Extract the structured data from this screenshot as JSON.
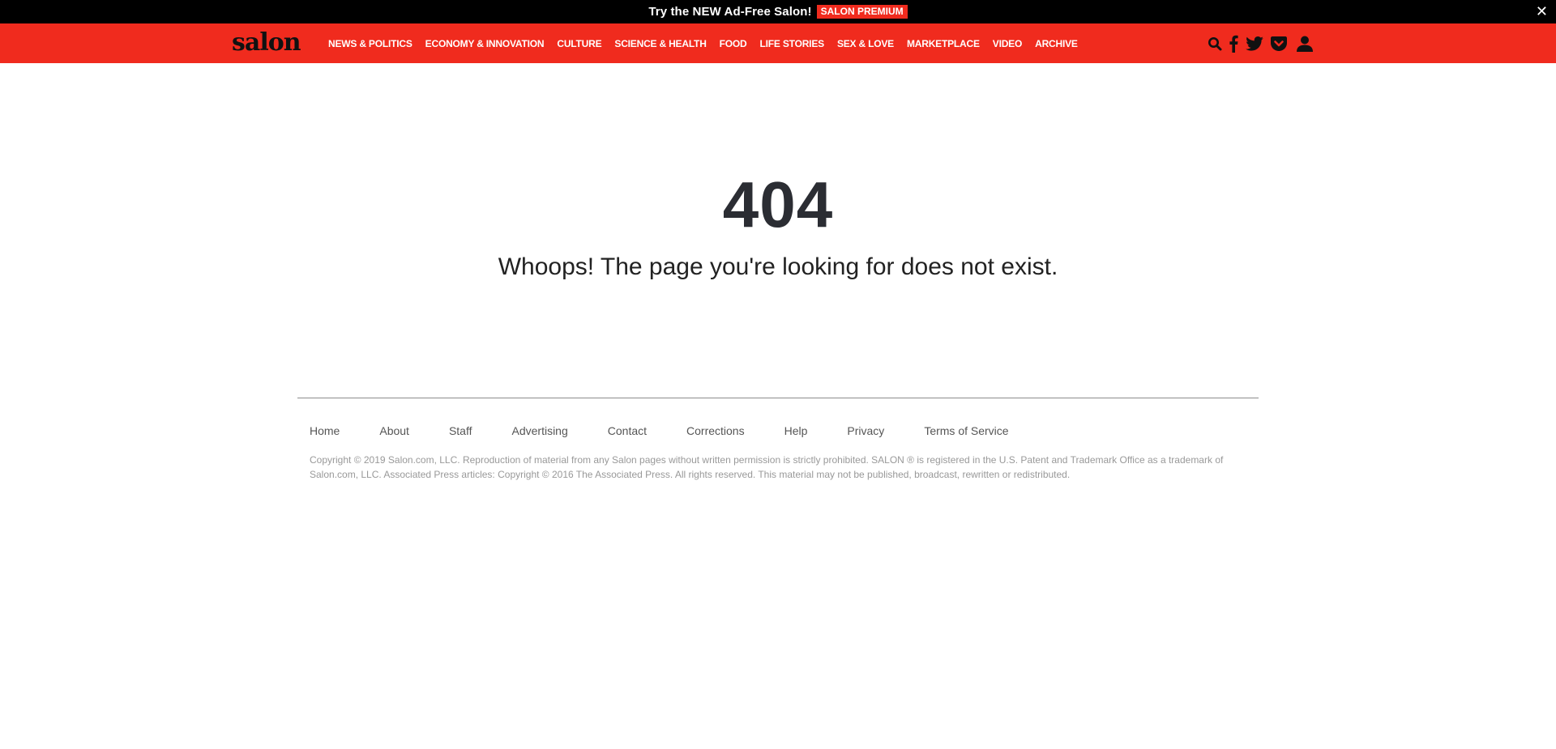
{
  "promo": {
    "text": "Try the NEW Ad-Free Salon!",
    "badge": "SALON PREMIUM",
    "close": "✕"
  },
  "header": {
    "logo": "salon",
    "nav": [
      "NEWS & POLITICS",
      "ECONOMY & INNOVATION",
      "CULTURE",
      "SCIENCE & HEALTH",
      "FOOD",
      "LIFE STORIES",
      "SEX & LOVE",
      "MARKETPLACE",
      "VIDEO",
      "ARCHIVE"
    ],
    "icons": [
      "search-icon",
      "facebook-icon",
      "twitter-icon",
      "pocket-icon",
      "user-icon"
    ]
  },
  "main": {
    "code": "404",
    "message": "Whoops! The page you're looking for does not exist."
  },
  "footer": {
    "links": [
      "Home",
      "About",
      "Staff",
      "Advertising",
      "Contact",
      "Corrections",
      "Help",
      "Privacy",
      "Terms of Service"
    ],
    "copyright": "Copyright © 2019 Salon.com, LLC. Reproduction of material from any Salon pages without written permission is strictly prohibited. SALON ® is registered in the U.S. Patent and Trademark Office as a trademark of Salon.com, LLC. Associated Press articles: Copyright © 2016 The Associated Press. All rights reserved. This material may not be published, broadcast, rewritten or redistributed."
  },
  "colors": {
    "brand_red": "#f02b1e",
    "promo_bg": "#000000",
    "text_dark": "#2b2d33"
  }
}
